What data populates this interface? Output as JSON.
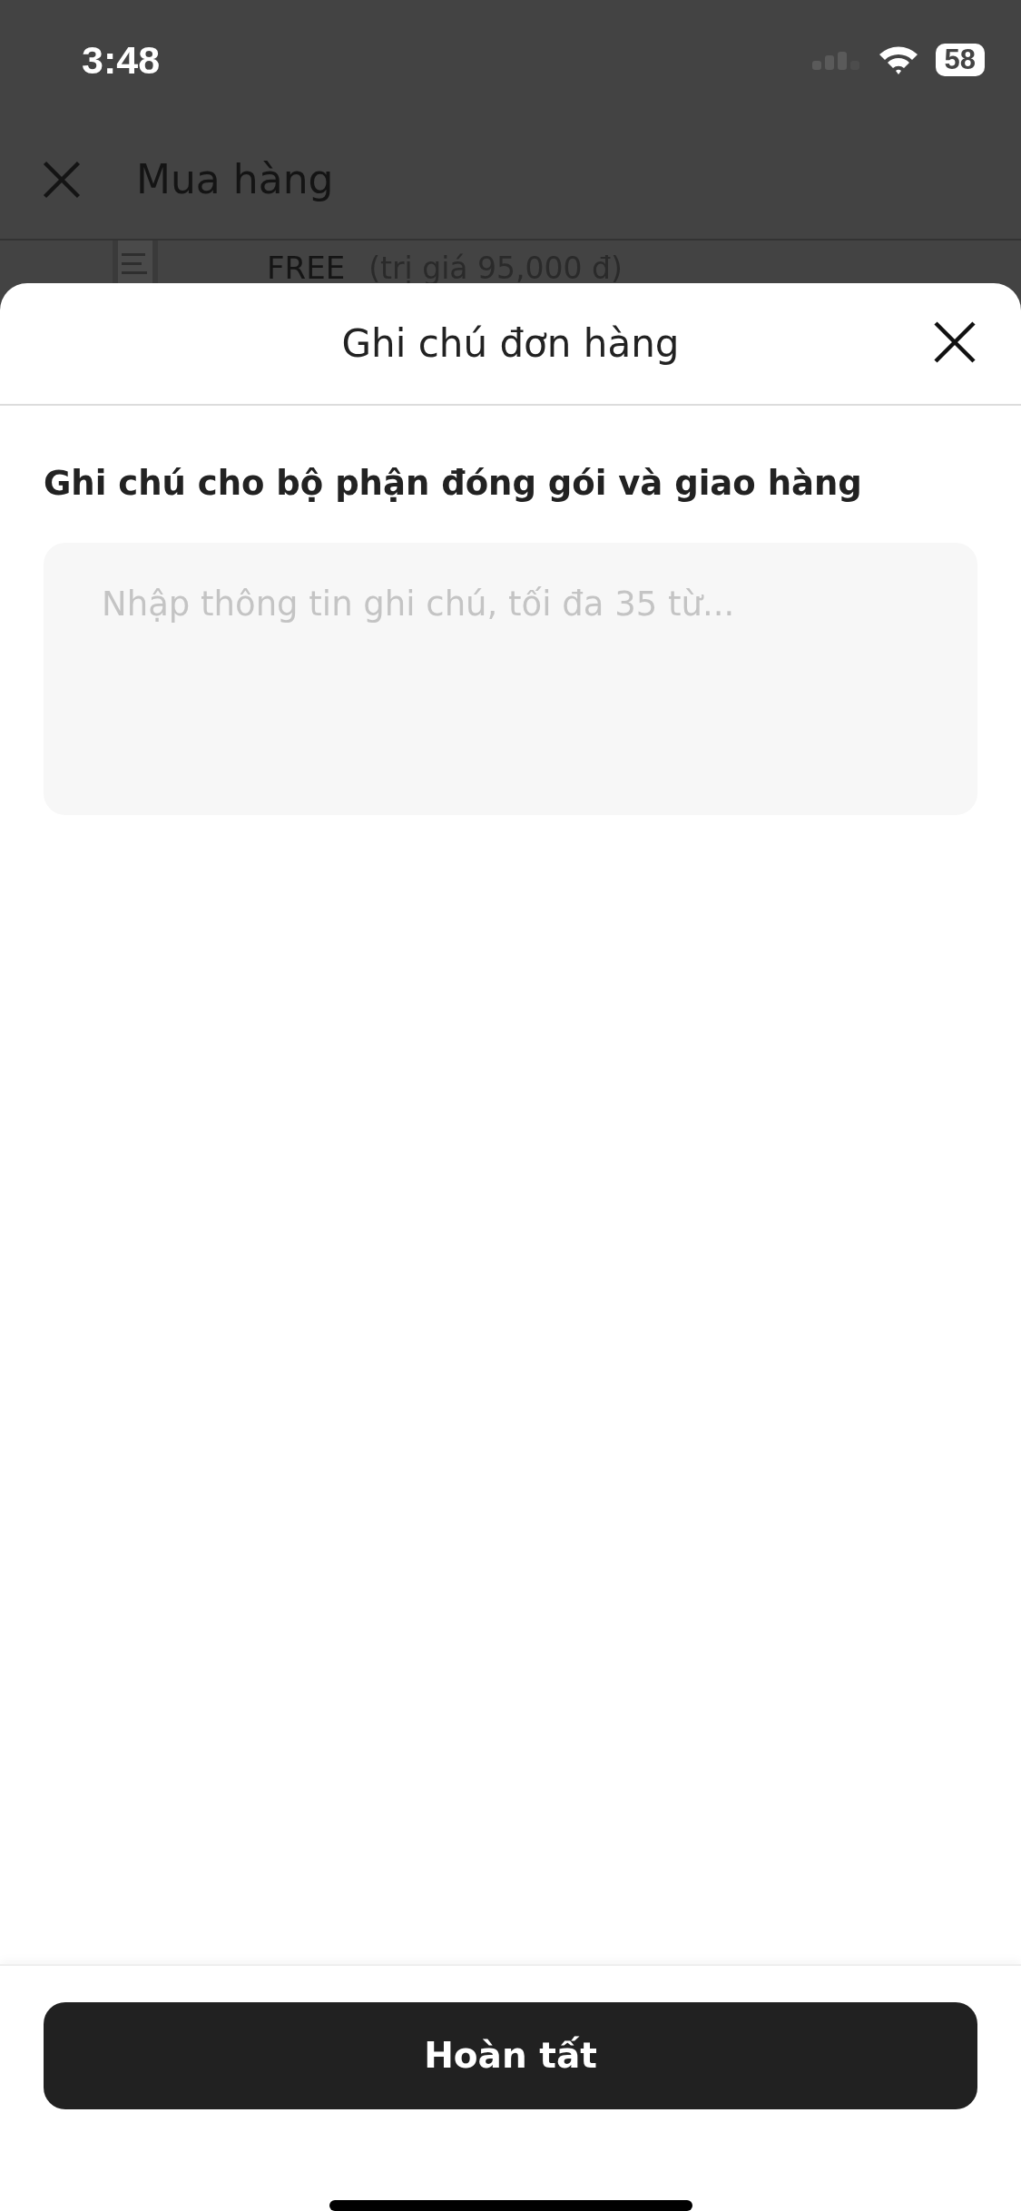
{
  "status_bar": {
    "time": "3:48",
    "battery": "58"
  },
  "background_page": {
    "title": "Mua hàng",
    "item": {
      "kind": "picture",
      "price": "FREE",
      "original_price": "(trị giá 95,000 đ)"
    }
  },
  "sheet": {
    "title": "Ghi chú đơn hàng",
    "label": "Ghi chú cho bộ phận đóng gói và giao hàng",
    "note_field": {
      "placeholder": "Nhập thông tin ghi chú, tối đa 35 từ..."
    },
    "button": "Hoàn tất"
  }
}
